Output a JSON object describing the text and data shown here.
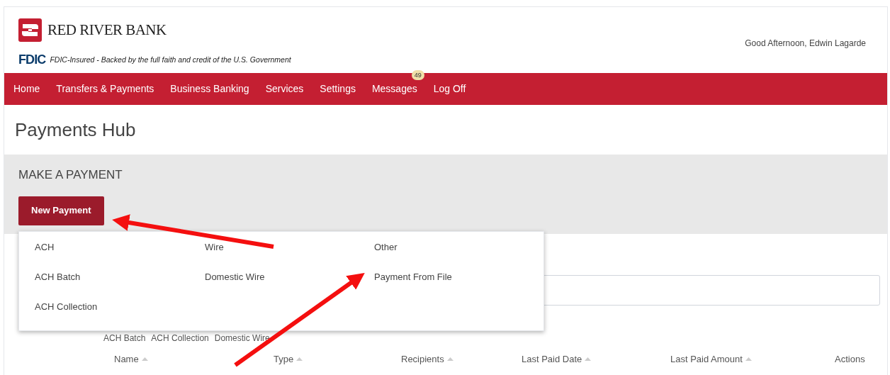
{
  "header": {
    "bank_name": "RED RIVER BANK",
    "fdic_logo": "FDIC",
    "fdic_notice": "FDIC-Insured - Backed by the full faith and credit of the U.S. Government",
    "greeting": "Good Afternoon, Edwin Lagarde"
  },
  "nav": {
    "items": [
      {
        "label": "Home"
      },
      {
        "label": "Transfers & Payments"
      },
      {
        "label": "Business Banking"
      },
      {
        "label": "Services"
      },
      {
        "label": "Settings"
      },
      {
        "label": "Messages",
        "badge": "49"
      },
      {
        "label": "Log Off"
      }
    ]
  },
  "page_title": "Payments Hub",
  "make_payment": {
    "heading": "MAKE A PAYMENT",
    "button": "New Payment",
    "menu": {
      "columns": [
        {
          "heading": "ACH",
          "items": [
            "ACH Batch",
            "ACH Collection"
          ]
        },
        {
          "heading": "Wire",
          "items": [
            "Domestic Wire"
          ]
        },
        {
          "heading": "Other",
          "items": [
            "Payment From File"
          ]
        }
      ]
    }
  },
  "filters": [
    "ACH Batch",
    "ACH Collection",
    "Domestic Wire"
  ],
  "table": {
    "columns": [
      {
        "label": "Name",
        "sortable": true
      },
      {
        "label": "Type",
        "sortable": true
      },
      {
        "label": "Recipients",
        "sortable": true
      },
      {
        "label": "Last Paid Date",
        "sortable": true
      },
      {
        "label": "Last Paid Amount",
        "sortable": true
      },
      {
        "label": "Actions",
        "sortable": false
      }
    ]
  }
}
